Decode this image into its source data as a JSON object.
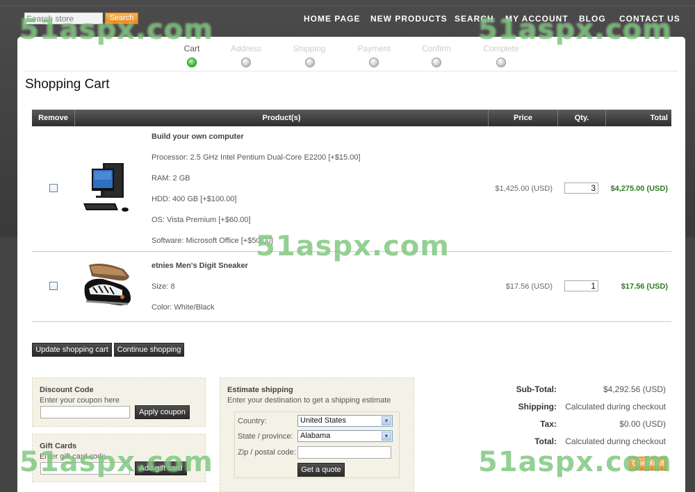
{
  "header": {
    "search_placeholder": "Search store",
    "search_button": "Search",
    "menu": [
      "HOME PAGE",
      "NEW PRODUCTS",
      "SEARCH",
      "MY ACCOUNT",
      "BLOG",
      "CONTACT US"
    ]
  },
  "steps": [
    {
      "label": "Cart",
      "active": true
    },
    {
      "label": "Address",
      "active": false
    },
    {
      "label": "Shipping",
      "active": false
    },
    {
      "label": "Payment",
      "active": false
    },
    {
      "label": "Confirm",
      "active": false
    },
    {
      "label": "Complete",
      "active": false
    }
  ],
  "page_title": "Shopping Cart",
  "table": {
    "headers": [
      "Remove",
      "Product(s)",
      "Price",
      "Qty.",
      "Total"
    ],
    "rows": [
      {
        "name": "Build your own computer",
        "attributes": [
          "Processor: 2.5 GHz Intel Pentium Dual-Core E2200 [+$15.00]",
          "RAM: 2 GB",
          "HDD: 400 GB [+$100.00]",
          "OS: Vista Premium [+$60.00]",
          "Software: Microsoft Office [+$50.00]"
        ],
        "price": "$1,425.00 (USD)",
        "qty": "3",
        "total": "$4,275.00 (USD)"
      },
      {
        "name": "etnies Men's Digit Sneaker",
        "attributes": [
          "Size: 8",
          "Color: White/Black"
        ],
        "price": "$17.56 (USD)",
        "qty": "1",
        "total": "$17.56 (USD)"
      }
    ]
  },
  "buttons": {
    "update_cart": "Update shopping cart",
    "continue_shopping": "Continue shopping"
  },
  "discount": {
    "title": "Discount Code",
    "hint": "Enter your coupon here",
    "button": "Apply coupon"
  },
  "giftcards": {
    "title": "Gift Cards",
    "hint": "Enter gift card code",
    "button": "Add gift card"
  },
  "estimate": {
    "title": "Estimate shipping",
    "hint": "Enter your destination to get a shipping estimate",
    "country_label": "Country:",
    "country_value": "United States",
    "state_label": "State / province:",
    "state_value": "Alabama",
    "zip_label": "Zip / postal code:",
    "button": "Get a quote"
  },
  "summary": {
    "subtotal_label": "Sub-Total:",
    "subtotal_value": "$4,292.56 (USD)",
    "shipping_label": "Shipping:",
    "shipping_value": "Calculated during checkout",
    "tax_label": "Tax:",
    "tax_value": "$0.00 (USD)",
    "total_label": "Total:",
    "total_value": "Calculated during checkout",
    "checkout_button": "Checkout"
  },
  "watermark": "51aspx.com",
  "colors": {
    "accent_orange": "#e58a1a",
    "total_green": "#2b7a1f",
    "active_step_green": "#3dbb3a"
  }
}
